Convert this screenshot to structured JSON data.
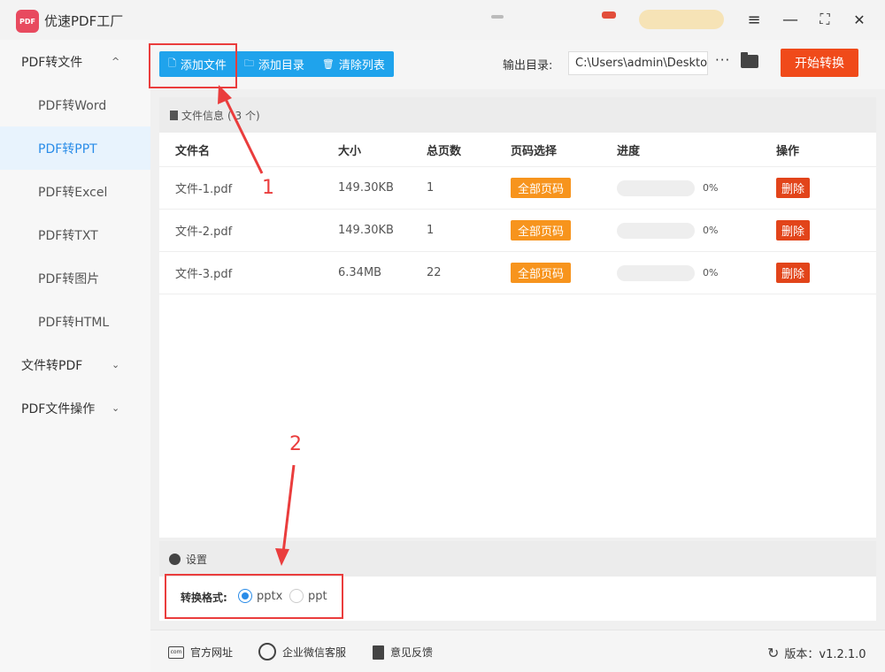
{
  "app": {
    "title": "优速PDF工厂",
    "logo_text": "PDF"
  },
  "window_controls": {
    "menu": "≡",
    "minimize": "—",
    "maximize": "⛶",
    "close": "✕"
  },
  "sidebar": {
    "groups": [
      {
        "label": "PDF转文件",
        "chevron": "^"
      },
      {
        "label": "文件转PDF",
        "chevron": "⌄"
      },
      {
        "label": "PDF文件操作",
        "chevron": "⌄"
      }
    ],
    "items": [
      {
        "label": "PDF转Word"
      },
      {
        "label": "PDF转PPT",
        "active": true
      },
      {
        "label": "PDF转Excel"
      },
      {
        "label": "PDF转TXT"
      },
      {
        "label": "PDF转图片"
      },
      {
        "label": "PDF转HTML"
      }
    ]
  },
  "toolbar": {
    "add_file": "添加文件",
    "add_folder": "添加目录",
    "clear_list": "清除列表",
    "output_label": "输出目录:",
    "output_path": "C:\\Users\\admin\\Deskto",
    "more": "···",
    "start": "开始转换"
  },
  "file_info": {
    "label": "文件信息",
    "count": "( 3 个)"
  },
  "table": {
    "headers": {
      "name": "文件名",
      "size": "大小",
      "pages": "总页数",
      "page_select": "页码选择",
      "progress": "进度",
      "action": "操作"
    },
    "rows": [
      {
        "name": "文件-1.pdf",
        "size": "149.30KB",
        "pages": "1",
        "page_select": "全部页码",
        "progress": 0,
        "progress_text": "0%",
        "action": "删除"
      },
      {
        "name": "文件-2.pdf",
        "size": "149.30KB",
        "pages": "1",
        "page_select": "全部页码",
        "progress": 0,
        "progress_text": "0%",
        "action": "删除"
      },
      {
        "name": "文件-3.pdf",
        "size": "6.34MB",
        "pages": "22",
        "page_select": "全部页码",
        "progress": 0,
        "progress_text": "0%",
        "action": "删除"
      }
    ]
  },
  "settings": {
    "title": "设置",
    "format_label": "转换格式:",
    "options": [
      {
        "label": "pptx",
        "selected": true
      },
      {
        "label": "ppt",
        "selected": false
      }
    ]
  },
  "footer": {
    "website": "官方网址",
    "wechat": "企业微信客服",
    "feedback": "意见反馈",
    "version": "版本：v1.2.1.0",
    "website_icon_text": "com"
  },
  "annotations": {
    "step1": "1",
    "step2": "2"
  },
  "colors": {
    "accent_blue": "#1fa3ec",
    "start_red": "#f04a1a",
    "tag_orange": "#f7941d",
    "delete_red": "#e2441a",
    "annot_red": "#ea3d3d"
  }
}
